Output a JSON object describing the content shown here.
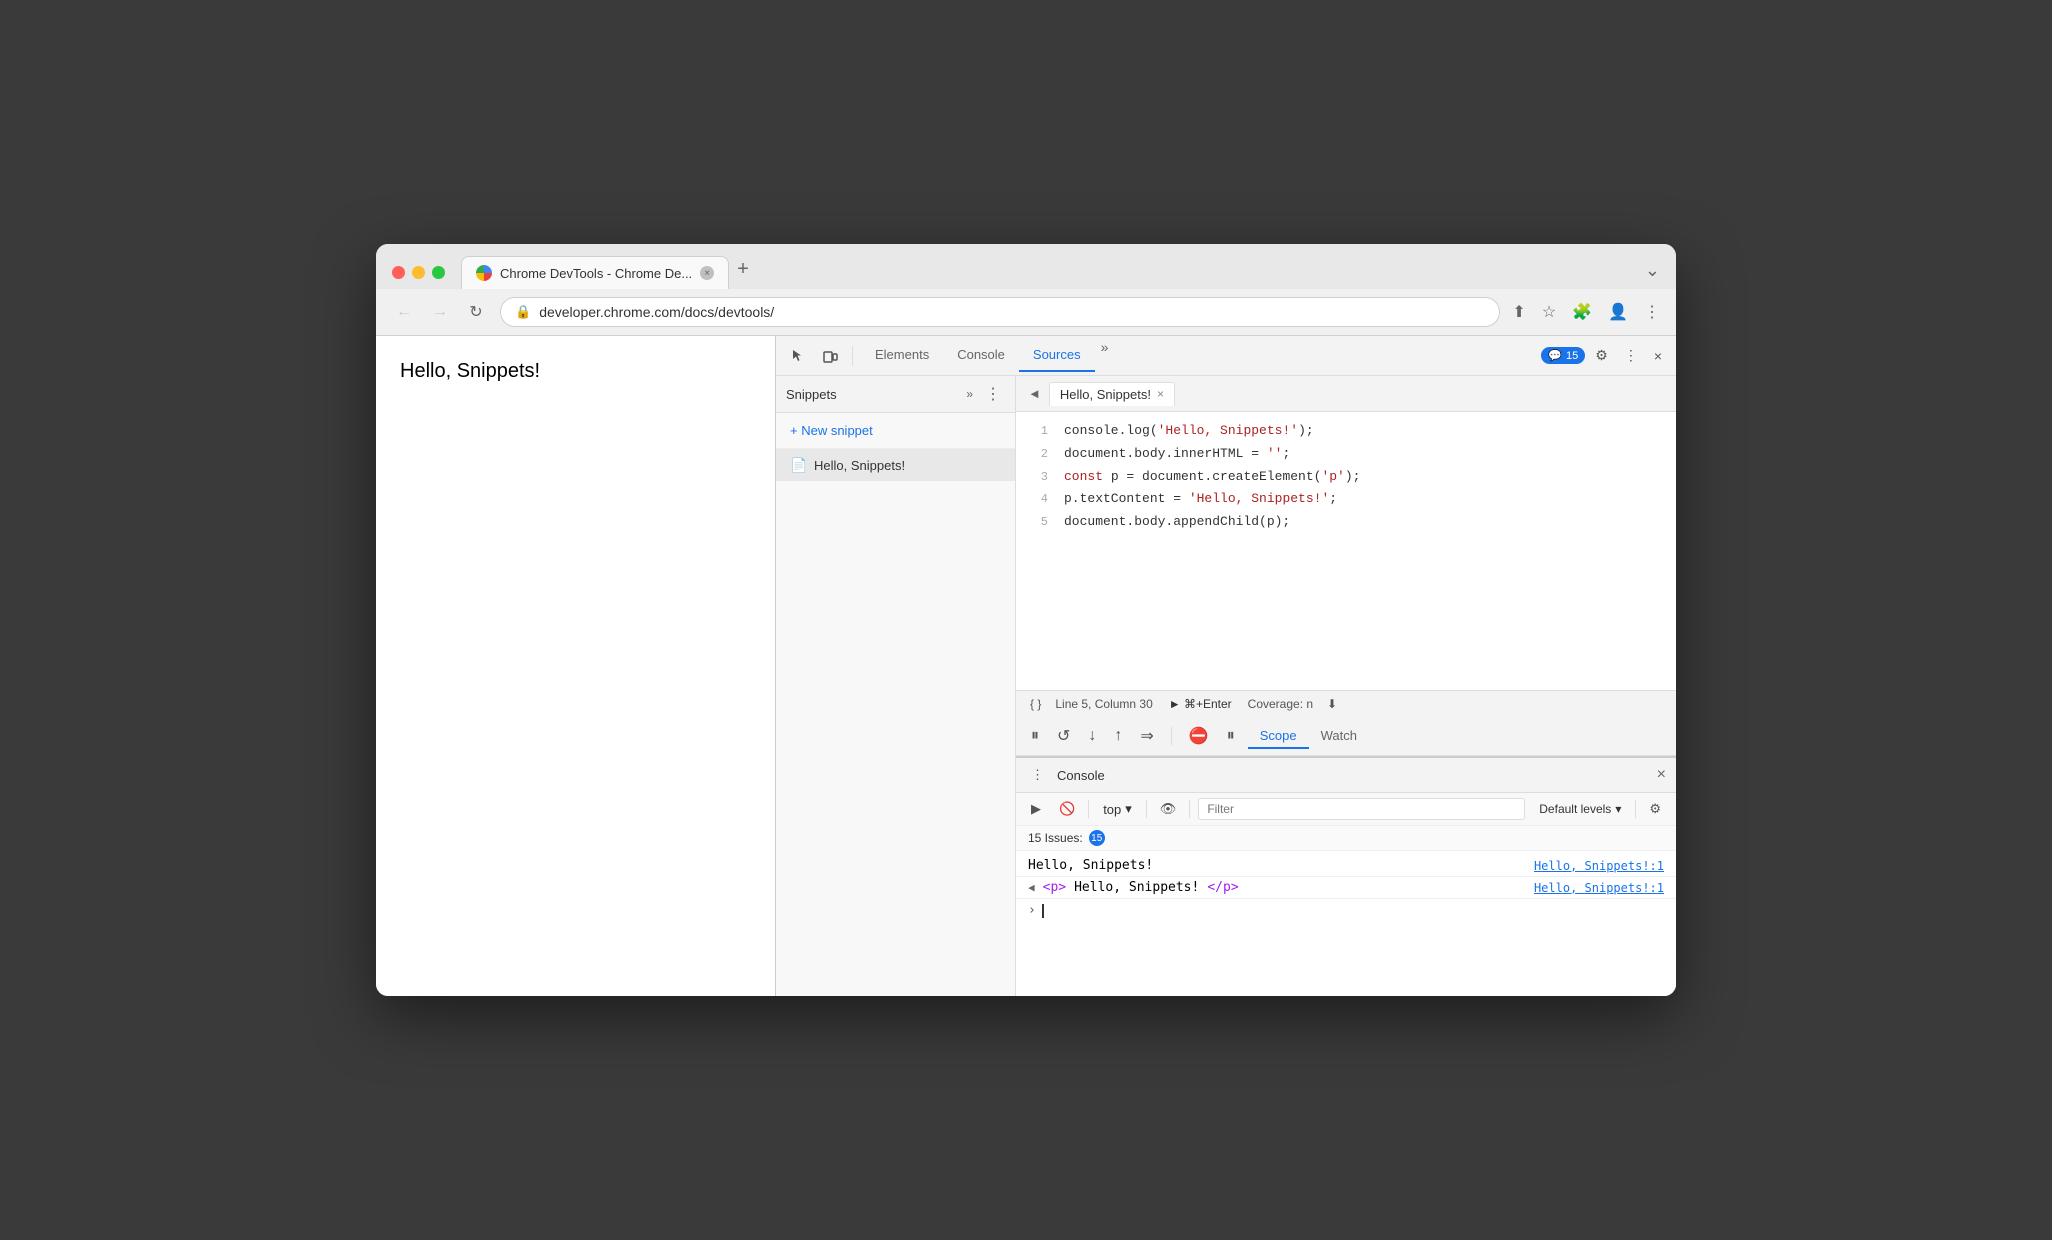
{
  "browser": {
    "tab_title": "Chrome DevTools - Chrome De...",
    "tab_close": "×",
    "new_tab": "+",
    "overflow": "⌄",
    "url": "developer.chrome.com/docs/devtools/",
    "nav_back": "←",
    "nav_forward": "→",
    "nav_refresh": "↻"
  },
  "page": {
    "hello_snippets": "Hello, Snippets!"
  },
  "devtools": {
    "tabs": [
      "Elements",
      "Console",
      "Sources"
    ],
    "active_tab": "Sources",
    "more": "»",
    "badge_label": "15",
    "settings_icon": "⚙",
    "more_vert": "⋮",
    "close": "×"
  },
  "snippets_panel": {
    "title": "Snippets",
    "chevron": "»",
    "more_btn": "⋮",
    "new_snippet_label": "+ New snippet",
    "snippet_name": "Hello, Snippets!"
  },
  "editor": {
    "tab_back": "◄",
    "tab_label": "Hello, Snippets!",
    "tab_close": "×",
    "code_lines": [
      {
        "num": 1,
        "text": "console.log('Hello, Snippets!');"
      },
      {
        "num": 2,
        "text": "document.body.innerHTML = '';"
      },
      {
        "num": 3,
        "text": "const p = document.createElement('p');"
      },
      {
        "num": 4,
        "text": "p.textContent = 'Hello, Snippets!';"
      },
      {
        "num": 5,
        "text": "document.body.appendChild(p);"
      }
    ],
    "status_format": "{}",
    "status_position": "Line 5, Column 30",
    "run_label": "► ⌘+Enter",
    "coverage_label": "Coverage: n",
    "expand_icon": "⬇"
  },
  "debugger": {
    "pause_btn": "⏸",
    "step_over": "↺",
    "step_into": "↓",
    "step_out": "↑",
    "step_next": "⇒",
    "breakpoints_btn": "⛔",
    "pause_excl": "⏸",
    "scope_label": "Scope",
    "watch_label": "Watch"
  },
  "console": {
    "title": "Console",
    "close": "×",
    "execute_btn": "▶",
    "block_btn": "🚫",
    "top_label": "top",
    "eye_icon": "👁",
    "filter_placeholder": "Filter",
    "default_levels_label": "Default levels",
    "issues_label": "15 Issues:",
    "issues_count": "15",
    "log_line1": "Hello, Snippets!",
    "log_link1": "Hello, Snippets!:1",
    "log_line2": "<p>Hello, Snippets!</p>",
    "log_link2": "Hello, Snippets!:1",
    "more_vert": "⋮",
    "settings_icon": "⚙",
    "caret_left": "◀"
  }
}
